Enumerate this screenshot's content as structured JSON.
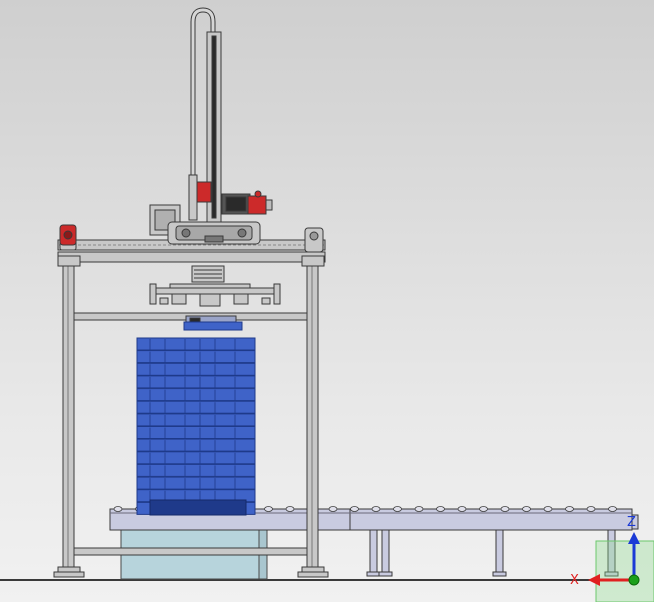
{
  "viewport": {
    "background_top": "#cfcfcf",
    "background_bottom": "#f1f1f1"
  },
  "model": {
    "frame_color": "#c8c8c8",
    "outline_color": "#3a3a3a",
    "motor_color": "#cc2a2a",
    "crate_color": "#3f63c8",
    "crate_dark": "#1f3a8a",
    "conveyor_color": "#c9cbe0",
    "base_block_color": "#b7d4dc",
    "crate_count": 14
  },
  "triad": {
    "x_label": "X",
    "z_label": "Z",
    "x_color": "#e02020",
    "z_color": "#1a3ad6",
    "origin_color": "#1aa01a",
    "box_color": "#8fdc8f"
  }
}
